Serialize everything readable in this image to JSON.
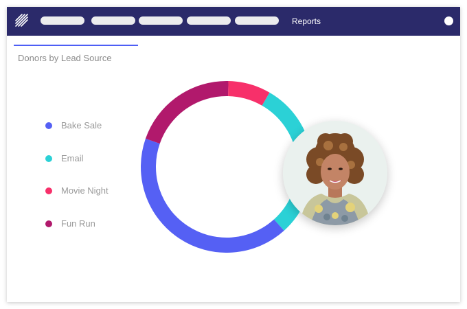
{
  "nav": {
    "reports_label": "Reports"
  },
  "panel": {
    "title": "Donors by Lead Source"
  },
  "colors": {
    "topbar": "#2b2a6a",
    "accent": "#4d5ef5"
  },
  "chart_data": {
    "type": "pie",
    "style": "donut",
    "title": "Donors by Lead Source",
    "categories": [
      "Bake Sale",
      "Email",
      "Movie Night",
      "Fun Run"
    ],
    "values": [
      42,
      30,
      8,
      20
    ],
    "colors": [
      "#5560f4",
      "#2bd1d6",
      "#f7306a",
      "#b1196c"
    ],
    "legend_position": "left"
  }
}
